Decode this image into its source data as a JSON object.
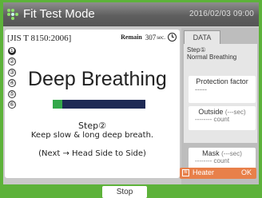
{
  "header": {
    "title": "Fit Test Mode",
    "datetime": "2016/02/03 09:00",
    "icon": "dots-logo-icon"
  },
  "main": {
    "standard": "[JIS T 8150:2006]",
    "remain_label": "Remain",
    "remain_value": "307",
    "remain_unit": "sec.",
    "steps": [
      "❶",
      "②",
      "③",
      "④",
      "⑤",
      "⑥"
    ],
    "active_step": 1,
    "exercise_title": "Deep Breathing",
    "progress": 0.1,
    "step_label": "Step②",
    "instruction": "Keep slow & long deep breath.",
    "next_note": "(Next → Head Side to Side)"
  },
  "side": {
    "tab": "DATA",
    "step_line1": "Step①",
    "step_line2": "Normal Breathing",
    "protection_title": "Protection factor",
    "protection_value": "-----",
    "outside_title": "Outside",
    "outside_unit": "(---sec)",
    "outside_count": "-------- count",
    "mask_title": "Mask",
    "mask_unit": "(---sec)",
    "mask_count": "-------- count"
  },
  "heater": {
    "icon": "heater-icon",
    "label": "Heater",
    "status": "OK"
  },
  "footer": {
    "stop_label": "Stop"
  },
  "colors": {
    "bezel": "#5db23a",
    "progress_fill": "#33a84a",
    "progress_track": "#1e2a55",
    "heater_bg": "#e8804a"
  }
}
